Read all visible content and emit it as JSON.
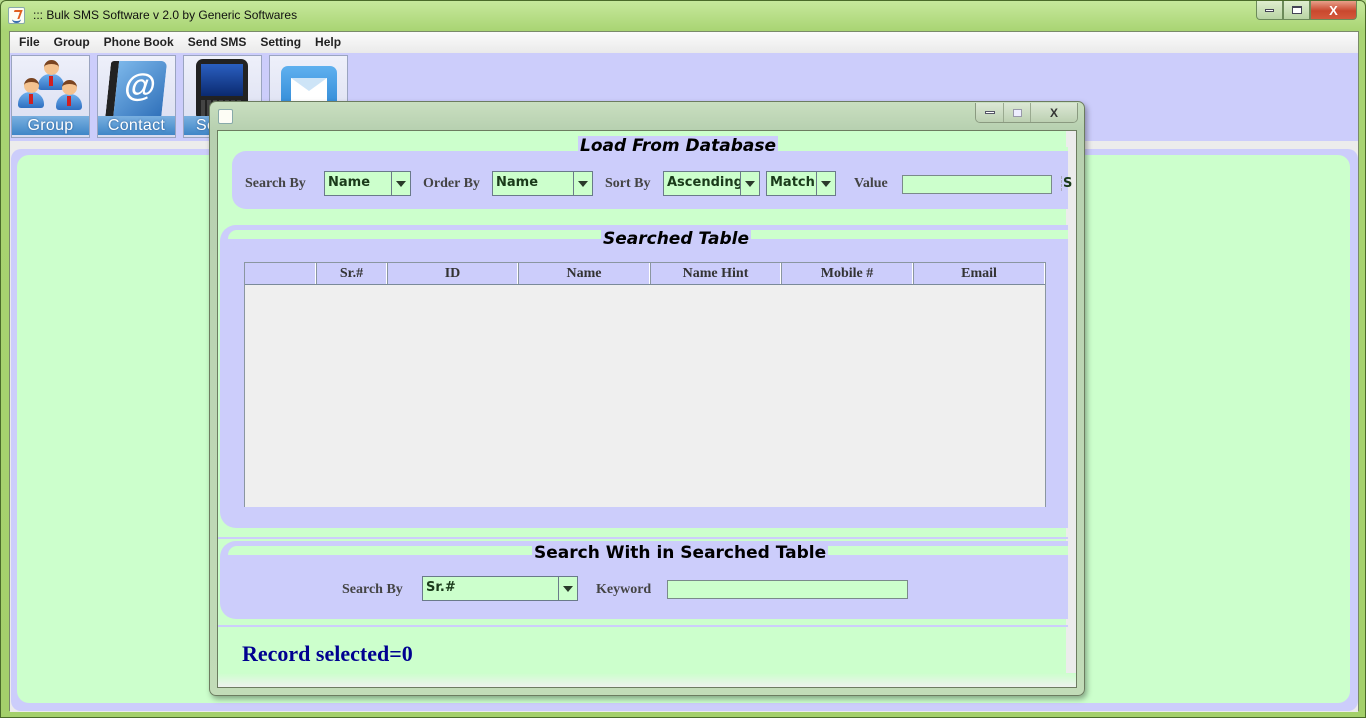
{
  "window": {
    "title": "::: Bulk SMS Software v 2.0 by Generic Softwares",
    "controls": {
      "minimize": "—",
      "maximize": "□",
      "close": "X"
    }
  },
  "menu": {
    "items": [
      {
        "label": "File"
      },
      {
        "label": "Group"
      },
      {
        "label": "Phone Book"
      },
      {
        "label": "Send SMS"
      },
      {
        "label": "Setting"
      },
      {
        "label": "Help"
      }
    ]
  },
  "toolbar": {
    "buttons": [
      {
        "label": "Group",
        "icon": "users-group-icon"
      },
      {
        "label": "Contact",
        "icon": "address-book-icon"
      },
      {
        "label": "Se",
        "icon": "mobile-phone-icon"
      },
      {
        "label": "",
        "icon": "envelope-icon"
      }
    ]
  },
  "dialog": {
    "controls": {
      "minimize": "—",
      "maximize": "□",
      "close": "X"
    },
    "load_section": {
      "title": "Load From Database",
      "search_by_label": "Search By",
      "search_by_value": "Name",
      "order_by_label": "Order By",
      "order_by_value": "Name",
      "sort_by_label": "Sort By",
      "sort_by_value": "Ascending",
      "match_value": "Match",
      "value_label": "Value",
      "value_input": "",
      "search_button_partial": "S"
    },
    "table_section": {
      "title": "Searched Table",
      "columns": [
        "",
        "Sr.#",
        "ID",
        "Name",
        "Name Hint",
        "Mobile #",
        "Email"
      ],
      "rows": []
    },
    "search_within_section": {
      "title": "Search With in Searched Table",
      "search_by_label": "Search By",
      "search_by_value": "Sr.#",
      "keyword_label": "Keyword",
      "keyword_input": ""
    },
    "status": {
      "record_selected": "Record selected=0"
    }
  }
}
